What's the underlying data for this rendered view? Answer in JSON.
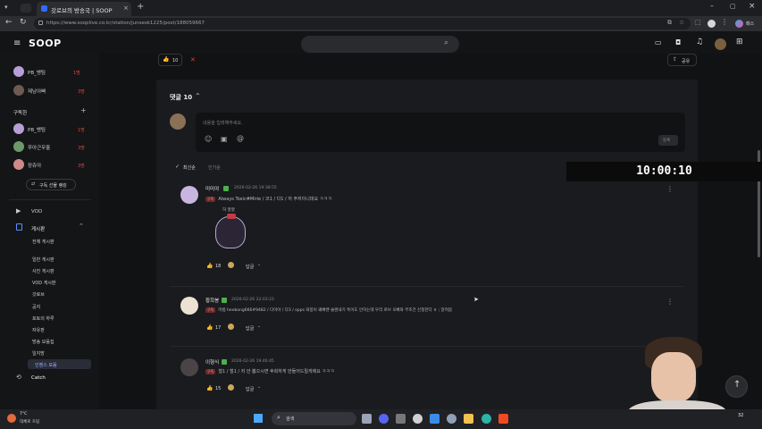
{
  "browser": {
    "tab_title": "갓로브의 방송국 | SOOP",
    "url": "https://www.sooplive.co.kr/station/junsesk1225/post/188059667",
    "profile_label": "패스"
  },
  "site": {
    "logo": "SOOP"
  },
  "sidebar": {
    "top_items": [
      {
        "label": "PB_뱅팀",
        "badge": "1명"
      },
      {
        "label": "제남아빠",
        "badge": "3명"
      }
    ],
    "subscribe_title": "구독한",
    "subscribe_items": [
      {
        "label": "PB_뱅팀",
        "badge": "1명"
      },
      {
        "label": "쭈아근무홀",
        "badge": "3명"
      },
      {
        "label": "장쥬아",
        "badge": "3명"
      }
    ],
    "ranking_button": "구독 선물 랭킹",
    "nav": {
      "vod": "VOD",
      "board": "게시판",
      "all_board": "전체 게시판",
      "board_items": [
        "일반 게시판",
        "사진 게시판",
        "VOD 게시판"
      ],
      "group_title": "갓로브",
      "group_items": [
        "공지",
        "포토의 하루",
        "자유판",
        "방송 모음집",
        "일지방",
        "인벤스 모음"
      ],
      "catch": "Catch"
    }
  },
  "post": {
    "like_count": "10",
    "share_label": "공유"
  },
  "comments": {
    "header": "댓글 10",
    "input_placeholder": "내용을 입력해주세요.",
    "submit_label": "등록",
    "sort_latest": "최신순",
    "sort_popular": "인기순",
    "items": [
      {
        "author": "미미야",
        "date": "2026-02-26 19:38:55",
        "tag": "구독",
        "text": "Always Toxic#Mirie / 코1 / 다1 / 저 주저이니데요 ㅋㅋㅋ",
        "sticker_text": "하 깔깔",
        "likes": "18",
        "reply": "답글"
      },
      {
        "author": "황희봉",
        "date": "2026-02-26 22:03:23",
        "tag": "구독",
        "text": "마법 heebong666#9482 / 다이아 / 다3 / opps 와봉이 왜빠밴 슬렌내기 특이도 안하는데 우리 로브 오빠와 무조건 신청한다 ㅎ ; 알려봄",
        "likes": "17",
        "reply": "답글"
      },
      {
        "author": "이형식",
        "date": "2026-02-26 19:46:45",
        "tag": "구독",
        "text": "철1 / 철1 / 저 안 뽑으시면 후회하게 만들어드릴게에요 ㅋㅋㅋ",
        "likes": "15",
        "reply": "답글"
      }
    ]
  },
  "overlay": {
    "timer": "10:00:10"
  },
  "taskbar": {
    "weather_temp": "7°C",
    "weather_text": "대체로 흐림",
    "search_label": "검색",
    "clock": "32"
  }
}
